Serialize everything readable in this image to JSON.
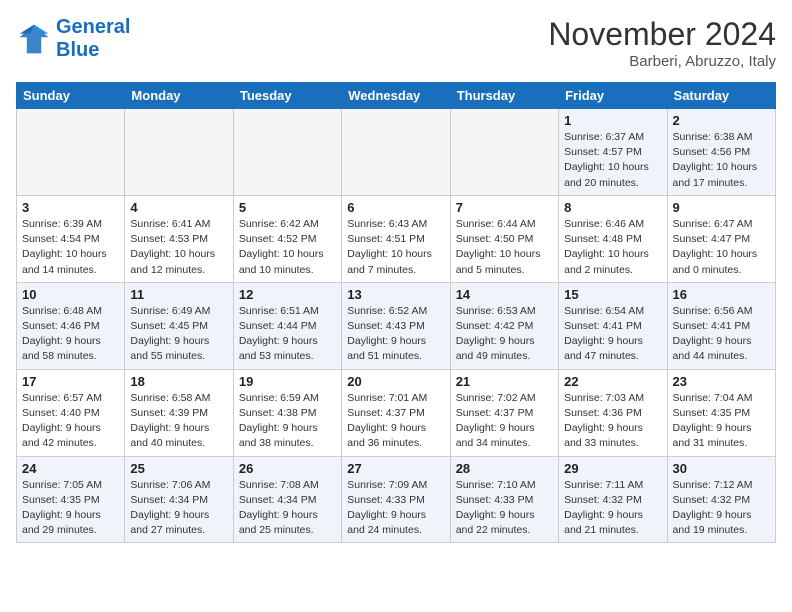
{
  "header": {
    "logo_line1": "General",
    "logo_line2": "Blue",
    "month": "November 2024",
    "location": "Barberi, Abruzzo, Italy"
  },
  "days_of_week": [
    "Sunday",
    "Monday",
    "Tuesday",
    "Wednesday",
    "Thursday",
    "Friday",
    "Saturday"
  ],
  "weeks": [
    [
      {
        "day": "",
        "info": "",
        "empty": true
      },
      {
        "day": "",
        "info": "",
        "empty": true
      },
      {
        "day": "",
        "info": "",
        "empty": true
      },
      {
        "day": "",
        "info": "",
        "empty": true
      },
      {
        "day": "",
        "info": "",
        "empty": true
      },
      {
        "day": "1",
        "info": "Sunrise: 6:37 AM\nSunset: 4:57 PM\nDaylight: 10 hours and 20 minutes."
      },
      {
        "day": "2",
        "info": "Sunrise: 6:38 AM\nSunset: 4:56 PM\nDaylight: 10 hours and 17 minutes."
      }
    ],
    [
      {
        "day": "3",
        "info": "Sunrise: 6:39 AM\nSunset: 4:54 PM\nDaylight: 10 hours and 14 minutes."
      },
      {
        "day": "4",
        "info": "Sunrise: 6:41 AM\nSunset: 4:53 PM\nDaylight: 10 hours and 12 minutes."
      },
      {
        "day": "5",
        "info": "Sunrise: 6:42 AM\nSunset: 4:52 PM\nDaylight: 10 hours and 10 minutes."
      },
      {
        "day": "6",
        "info": "Sunrise: 6:43 AM\nSunset: 4:51 PM\nDaylight: 10 hours and 7 minutes."
      },
      {
        "day": "7",
        "info": "Sunrise: 6:44 AM\nSunset: 4:50 PM\nDaylight: 10 hours and 5 minutes."
      },
      {
        "day": "8",
        "info": "Sunrise: 6:46 AM\nSunset: 4:48 PM\nDaylight: 10 hours and 2 minutes."
      },
      {
        "day": "9",
        "info": "Sunrise: 6:47 AM\nSunset: 4:47 PM\nDaylight: 10 hours and 0 minutes."
      }
    ],
    [
      {
        "day": "10",
        "info": "Sunrise: 6:48 AM\nSunset: 4:46 PM\nDaylight: 9 hours and 58 minutes."
      },
      {
        "day": "11",
        "info": "Sunrise: 6:49 AM\nSunset: 4:45 PM\nDaylight: 9 hours and 55 minutes."
      },
      {
        "day": "12",
        "info": "Sunrise: 6:51 AM\nSunset: 4:44 PM\nDaylight: 9 hours and 53 minutes."
      },
      {
        "day": "13",
        "info": "Sunrise: 6:52 AM\nSunset: 4:43 PM\nDaylight: 9 hours and 51 minutes."
      },
      {
        "day": "14",
        "info": "Sunrise: 6:53 AM\nSunset: 4:42 PM\nDaylight: 9 hours and 49 minutes."
      },
      {
        "day": "15",
        "info": "Sunrise: 6:54 AM\nSunset: 4:41 PM\nDaylight: 9 hours and 47 minutes."
      },
      {
        "day": "16",
        "info": "Sunrise: 6:56 AM\nSunset: 4:41 PM\nDaylight: 9 hours and 44 minutes."
      }
    ],
    [
      {
        "day": "17",
        "info": "Sunrise: 6:57 AM\nSunset: 4:40 PM\nDaylight: 9 hours and 42 minutes."
      },
      {
        "day": "18",
        "info": "Sunrise: 6:58 AM\nSunset: 4:39 PM\nDaylight: 9 hours and 40 minutes."
      },
      {
        "day": "19",
        "info": "Sunrise: 6:59 AM\nSunset: 4:38 PM\nDaylight: 9 hours and 38 minutes."
      },
      {
        "day": "20",
        "info": "Sunrise: 7:01 AM\nSunset: 4:37 PM\nDaylight: 9 hours and 36 minutes."
      },
      {
        "day": "21",
        "info": "Sunrise: 7:02 AM\nSunset: 4:37 PM\nDaylight: 9 hours and 34 minutes."
      },
      {
        "day": "22",
        "info": "Sunrise: 7:03 AM\nSunset: 4:36 PM\nDaylight: 9 hours and 33 minutes."
      },
      {
        "day": "23",
        "info": "Sunrise: 7:04 AM\nSunset: 4:35 PM\nDaylight: 9 hours and 31 minutes."
      }
    ],
    [
      {
        "day": "24",
        "info": "Sunrise: 7:05 AM\nSunset: 4:35 PM\nDaylight: 9 hours and 29 minutes."
      },
      {
        "day": "25",
        "info": "Sunrise: 7:06 AM\nSunset: 4:34 PM\nDaylight: 9 hours and 27 minutes."
      },
      {
        "day": "26",
        "info": "Sunrise: 7:08 AM\nSunset: 4:34 PM\nDaylight: 9 hours and 25 minutes."
      },
      {
        "day": "27",
        "info": "Sunrise: 7:09 AM\nSunset: 4:33 PM\nDaylight: 9 hours and 24 minutes."
      },
      {
        "day": "28",
        "info": "Sunrise: 7:10 AM\nSunset: 4:33 PM\nDaylight: 9 hours and 22 minutes."
      },
      {
        "day": "29",
        "info": "Sunrise: 7:11 AM\nSunset: 4:32 PM\nDaylight: 9 hours and 21 minutes."
      },
      {
        "day": "30",
        "info": "Sunrise: 7:12 AM\nSunset: 4:32 PM\nDaylight: 9 hours and 19 minutes."
      }
    ]
  ]
}
